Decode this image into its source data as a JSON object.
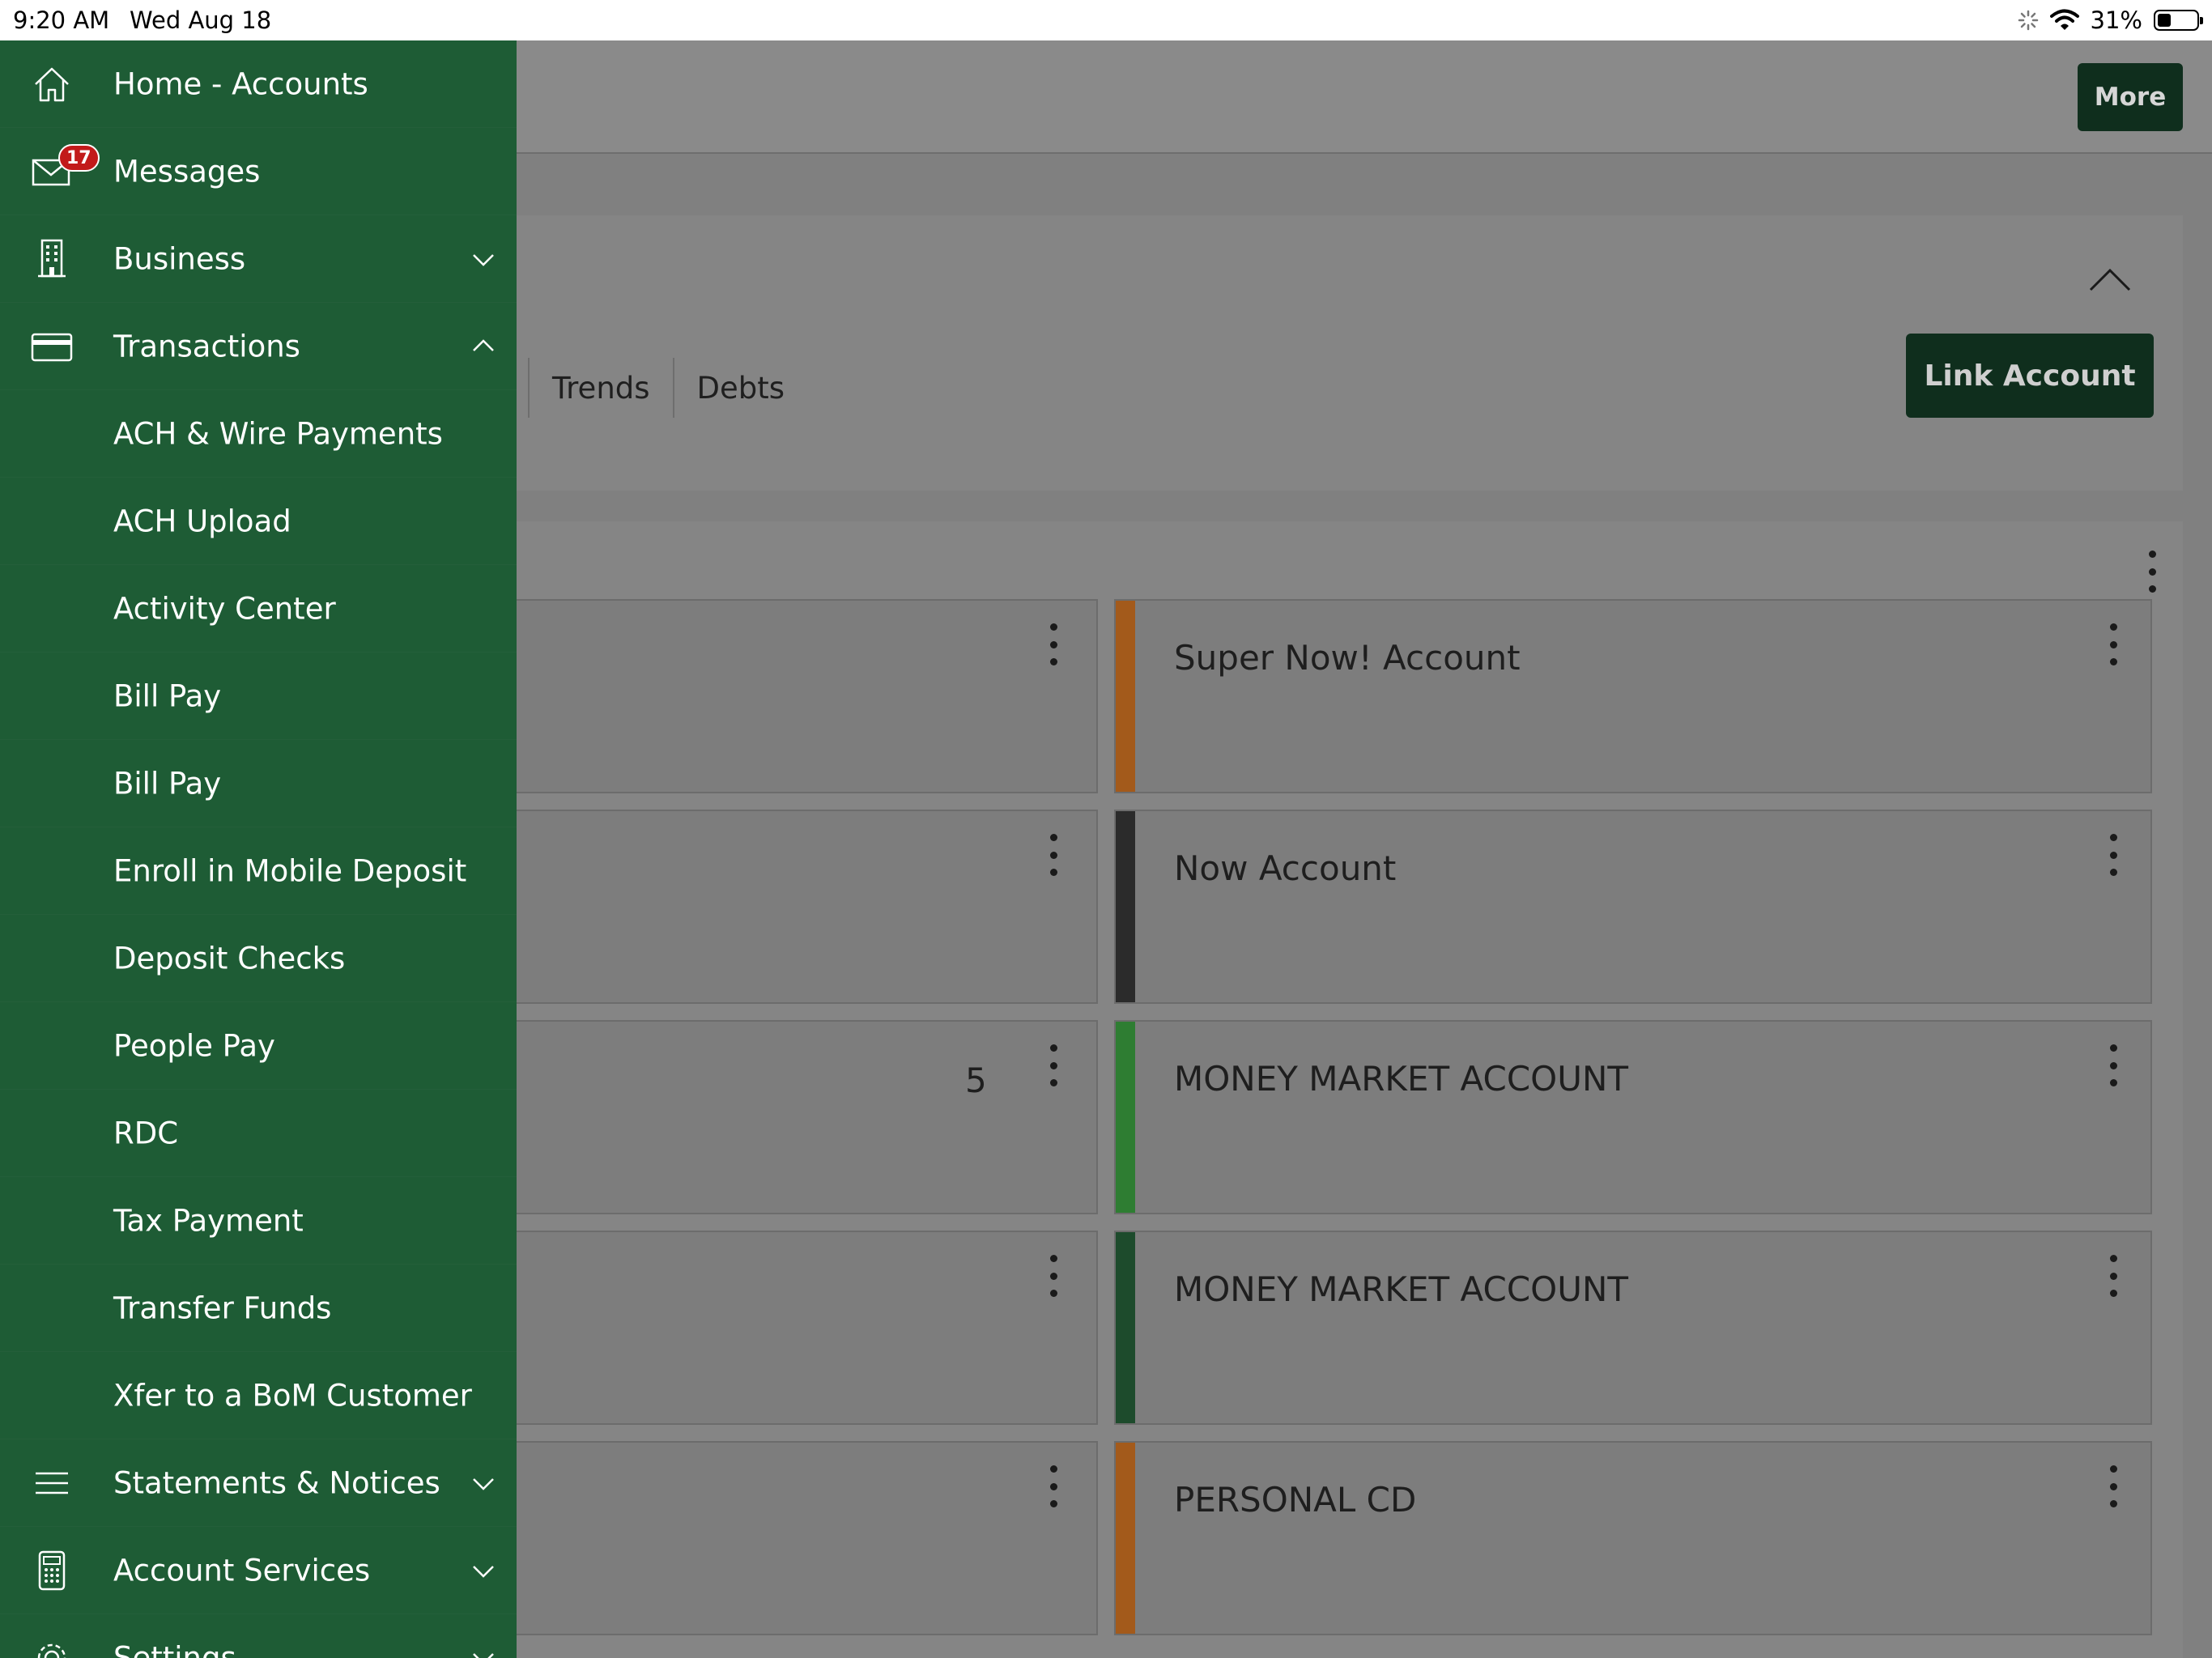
{
  "status_bar": {
    "time": "9:20 AM",
    "date": "Wed Aug 18",
    "battery": "31%"
  },
  "header": {
    "more_label": "More"
  },
  "overview": {
    "tabs": [
      "Trends",
      "Debts"
    ],
    "link_account_label": "Link Account"
  },
  "accounts": {
    "left_fragment": "5",
    "cards": [
      {
        "name": "Super Now! Account",
        "color": "#a35a1b"
      },
      {
        "name": "Now Account",
        "color": "#2b2b2b"
      },
      {
        "name": "MONEY MARKET ACCOUNT",
        "color": "#2e7d32"
      },
      {
        "name": "MONEY MARKET ACCOUNT",
        "color": "#1d4b2c"
      },
      {
        "name": "PERSONAL CD",
        "color": "#a35a1b"
      }
    ]
  },
  "menu": {
    "home": "Home - Accounts",
    "messages": "Messages",
    "messages_badge": "17",
    "business": "Business",
    "transactions": "Transactions",
    "transactions_items": [
      "ACH & Wire Payments",
      "ACH Upload",
      "Activity Center",
      "Bill Pay",
      "Bill Pay",
      "Enroll in Mobile Deposit",
      "Deposit Checks",
      "People Pay",
      "RDC",
      "Tax Payment",
      "Transfer Funds",
      "Xfer to a BoM Customer"
    ],
    "statements": "Statements & Notices",
    "account_services": "Account Services",
    "settings": "Settings"
  }
}
